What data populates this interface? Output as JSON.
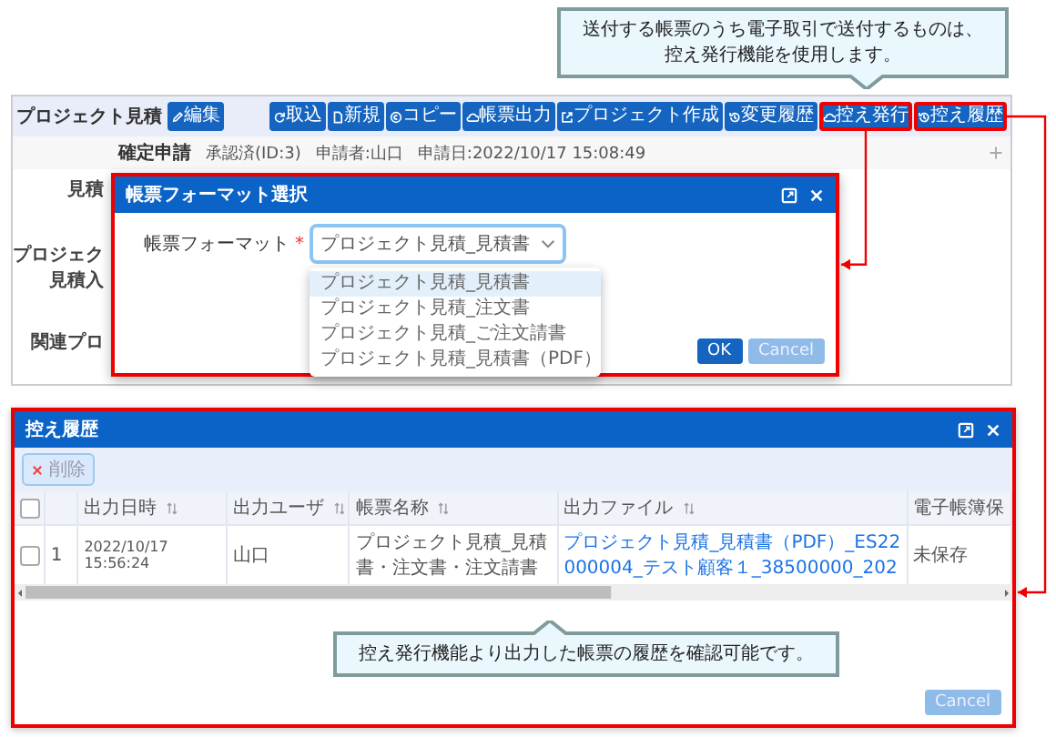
{
  "top_callout": {
    "lines": [
      "送付する帳票のうち電子取引で送付するものは、",
      "控え発行機能を使用します。"
    ]
  },
  "project": {
    "title": "プロジェクト見積",
    "edit_button": "編集",
    "toolbar": [
      {
        "label": "取込",
        "highlighted": false
      },
      {
        "label": "新規",
        "highlighted": false
      },
      {
        "label": "コピー",
        "highlighted": false
      },
      {
        "label": "帳票出力",
        "highlighted": false
      },
      {
        "label": "プロジェクト作成",
        "highlighted": false
      },
      {
        "label": "変更履歴",
        "highlighted": false
      },
      {
        "label": "控え発行",
        "highlighted": true
      },
      {
        "label": "控え履歴",
        "highlighted": true
      }
    ],
    "status_row": {
      "label": "確定申請",
      "status": "承認済(ID:3)",
      "applicant": "申請者:山口",
      "date": "申請日:2022/10/17 15:08:49"
    },
    "form_labels": [
      "見積",
      "プロジェク",
      "見積入",
      "関連プロ"
    ]
  },
  "format_dialog": {
    "title": "帳票フォーマット選択",
    "highlighted": true,
    "field": {
      "label": "帳票フォーマット",
      "required_mark": "*",
      "value": "プロジェクト見積_見積書",
      "expanded": true
    },
    "options": [
      {
        "label": "プロジェクト見積_見積書",
        "selected": true
      },
      {
        "label": "プロジェクト見積_注文書",
        "selected": false
      },
      {
        "label": "プロジェクト見積_ご注文請書",
        "selected": false
      },
      {
        "label": "プロジェクト見積_見積書（PDF）",
        "selected": false
      }
    ],
    "buttons": [
      {
        "label": "OK",
        "disabled": false
      },
      {
        "label": "Cancel",
        "disabled": true
      }
    ]
  },
  "history_dialog": {
    "title": "控え履歴",
    "highlighted": true,
    "delete_button": {
      "label": "削除",
      "disabled": true
    },
    "header_checkbox": {
      "checked": false
    },
    "columns": [
      {
        "label": "出力日時",
        "sortable": true
      },
      {
        "label": "出力ユーザ",
        "sortable": true
      },
      {
        "label": "帳票名称",
        "sortable": true
      },
      {
        "label": "出力ファイル",
        "sortable": true
      },
      {
        "label": "電子帳簿保"
      }
    ],
    "rows": [
      {
        "checked": false,
        "number": "1",
        "cells": [
          {
            "kind": "text",
            "text": "2022/10/17 15:56:24"
          },
          {
            "kind": "text",
            "text": "山口"
          },
          {
            "kind": "text",
            "text": "プロジェクト見積_見積書・注文書・注文請書"
          },
          {
            "kind": "link",
            "text": "プロジェクト見積_見積書（PDF）_ES22000004_テスト顧客１_38500000_202"
          },
          {
            "kind": "text",
            "text": "未保存"
          }
        ]
      }
    ],
    "callout": {
      "lines": [
        "控え発行機能より出力した帳票の履歴を確認可能です。"
      ]
    },
    "footer_button": {
      "label": "Cancel",
      "disabled": true
    }
  }
}
